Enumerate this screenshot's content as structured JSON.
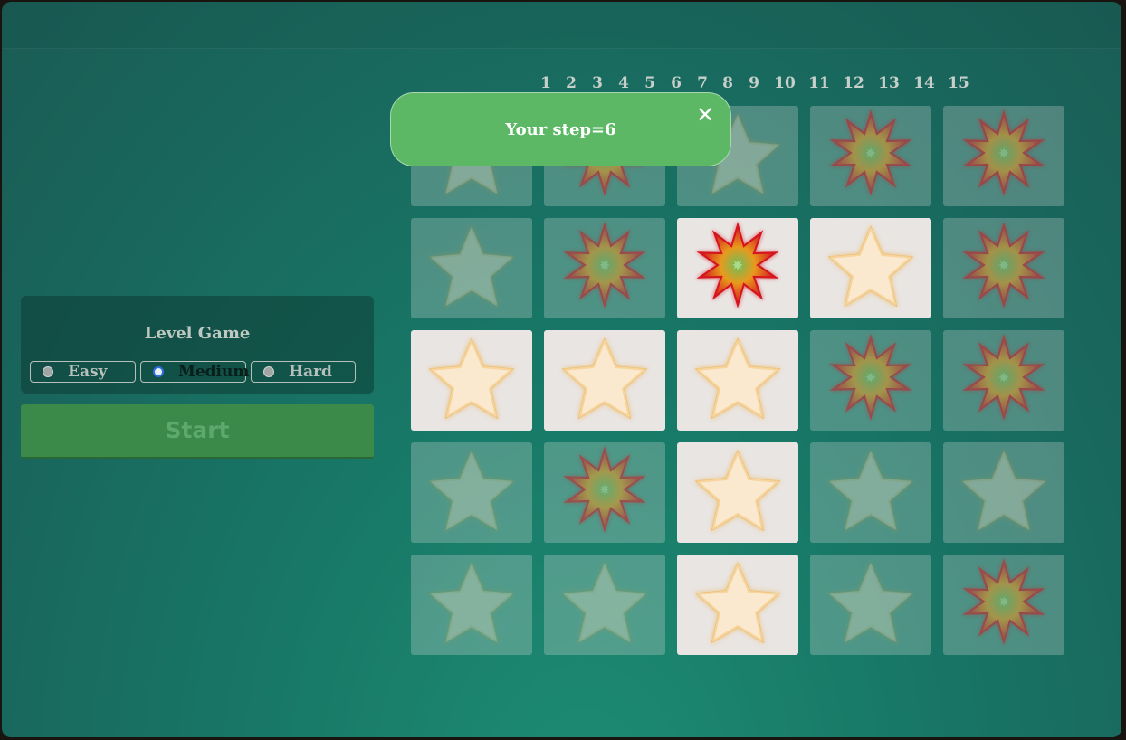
{
  "level": {
    "title": "Level Game",
    "options": [
      {
        "label": "Easy",
        "selected": false
      },
      {
        "label": "Medium",
        "selected": true
      },
      {
        "label": "Hard",
        "selected": false
      }
    ]
  },
  "start_label": "Start",
  "step_numbers": [
    "1",
    "2",
    "3",
    "4",
    "5",
    "6",
    "7",
    "8",
    "9",
    "10",
    "11",
    "12",
    "13",
    "14",
    "15"
  ],
  "toast": {
    "text": "Your step=6",
    "close_label": "✕"
  },
  "grid": {
    "rows": 5,
    "cols": 5,
    "cells": [
      [
        "star-hidden",
        "burst-hidden",
        "star-hidden",
        "burst-hidden",
        "burst-hidden"
      ],
      [
        "star-hidden",
        "burst-hidden",
        "burst-revealed",
        "star-revealed",
        "burst-hidden"
      ],
      [
        "star-revealed",
        "star-revealed",
        "star-revealed",
        "burst-hidden",
        "burst-hidden"
      ],
      [
        "star-hidden",
        "burst-hidden",
        "star-revealed",
        "star-hidden",
        "star-hidden"
      ],
      [
        "star-hidden",
        "star-hidden",
        "star-revealed",
        "star-hidden",
        "burst-hidden"
      ]
    ]
  },
  "colors": {
    "star_fill": "#fbe9cf",
    "star_glow": "#f0a21e",
    "burst_red": "#d4141e",
    "burst_orange": "#e89a1d",
    "burst_green": "#6dbd5a",
    "toast_bg": "#5cb865",
    "start_bg": "#3b8a4a"
  }
}
